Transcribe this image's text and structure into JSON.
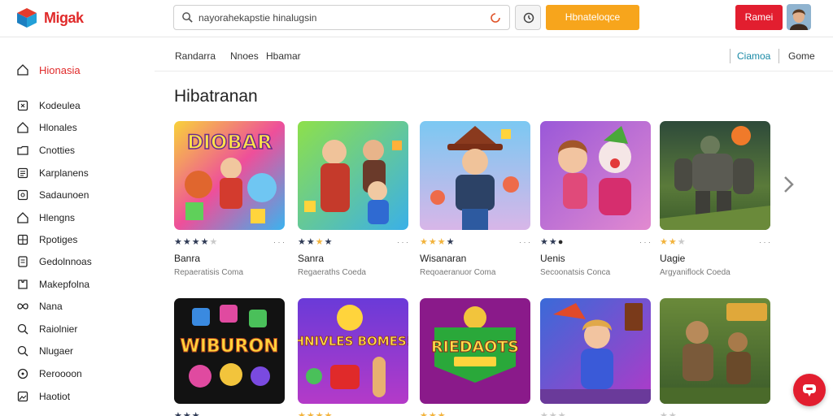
{
  "brand": {
    "name": "Migak"
  },
  "search": {
    "query": "nayorahekapstie hinalugsin"
  },
  "header": {
    "orange_label": "Hbnateloqce",
    "red_label": "Ramei"
  },
  "sidebar": {
    "items": [
      {
        "label": "Hionasia",
        "icon": "home-icon",
        "active": true
      },
      {
        "label": "Kodeulea",
        "icon": "bookmark-icon"
      },
      {
        "label": "Hlonales",
        "icon": "home-icon"
      },
      {
        "label": "Cnotties",
        "icon": "folder-icon"
      },
      {
        "label": "Karplanens",
        "icon": "list-icon"
      },
      {
        "label": "Sadaunoen",
        "icon": "monitor-icon"
      },
      {
        "label": "Hlengns",
        "icon": "home-icon"
      },
      {
        "label": "Rpotiges",
        "icon": "grid-icon"
      },
      {
        "label": "Gedolnnoas",
        "icon": "document-icon"
      },
      {
        "label": "Makepfolna",
        "icon": "puzzle-icon"
      },
      {
        "label": "Nana",
        "icon": "infinity-icon"
      },
      {
        "label": "Raiolnier",
        "icon": "search-icon"
      },
      {
        "label": "Nlugaer",
        "icon": "search-icon"
      },
      {
        "label": "Reroooon",
        "icon": "globe-icon"
      },
      {
        "label": "Haotiot",
        "icon": "image-icon"
      }
    ]
  },
  "subnav": {
    "tabs_left": [
      "Randarra",
      "Nnoes",
      "Hbamar"
    ],
    "tabs_right": [
      "Ciamoa",
      "Gome"
    ]
  },
  "section": {
    "title": "Hibatranan"
  },
  "games_row1": [
    {
      "title": "Banra",
      "subtitle": "Repaeratisis Coma",
      "rating": 4,
      "palette": "blue"
    },
    {
      "title": "Sanra",
      "subtitle": "Regaeraths Coeda",
      "rating": 3,
      "palette": "green"
    },
    {
      "title": "Wisanaran",
      "subtitle": "Reqoaeranuor Coma",
      "rating": 3,
      "palette": "sky"
    },
    {
      "title": "Uenis",
      "subtitle": "Secoonatsis Conca",
      "rating": 2,
      "palette": "purple"
    },
    {
      "title": "Uagie",
      "subtitle": "Argyaniflock Coeda",
      "rating": 2,
      "palette": "dark"
    }
  ],
  "games_row2": [
    {
      "title": "WIBURON",
      "palette": "black"
    },
    {
      "title": "HNIVLES BOMES!",
      "palette": "violet"
    },
    {
      "title": "RIEDAOTS",
      "palette": "magenta"
    },
    {
      "title": "",
      "palette": "teal"
    },
    {
      "title": "",
      "palette": "olive"
    }
  ],
  "colors": {
    "brand_red": "#e02a2a",
    "orange": "#f7a51c",
    "accent_teal": "#1a8aa6"
  }
}
